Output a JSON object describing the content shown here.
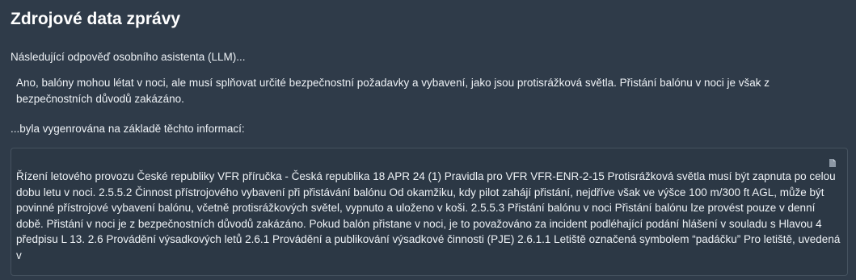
{
  "panel": {
    "title": "Zdrojové data zprávy",
    "intro": "Následující odpověď osobního asistenta (LLM)...",
    "answer": "Ano, balóny mohou létat v noci, ale musí splňovat určité bezpečnostní požadavky a vybavení, jako jsou protisrážková světla. Přistání balónu v noci je však z bezpečnostních důvodů zakázáno.",
    "basis": "...byla vygenrována na základě těchto informací:",
    "source": {
      "icon": "document-icon",
      "text": "Řízení letového provozu České republiky VFR příručka - Česká republika 18 APR 24 (1) Pravidla pro VFR VFR-ENR-2-15 Protisrážková světla musí být zapnuta po celou dobu letu v noci. 2.5.5.2 Činnost přístrojového vybavení při přistávání balónu Od okamžiku, kdy pilot zahájí přistání, nejdříve však ve výšce 100 m/300 ft AGL, může být povinné přístrojové vybavení balónu, včetně protisrážkových světel, vypnuto a uloženo v koši. 2.5.5.3 Přistání balónu v noci Přistání balónu lze provést pouze v denní době. Přistání v noci je z bezpečnostních důvodů zakázáno. Pokud balón přistane v noci, je to považováno za incident podléhající podání hlášení v souladu s Hlavou 4 předpisu L 13. 2.6 Provádění výsadkových letů 2.6.1 Provádění a publikování výsadkové činnosti (PJE) 2.6.1.1 Letiště označená symbolem “padáčku” Pro letiště, uvedená v"
    }
  },
  "colors": {
    "background": "#2f3b49",
    "box_background": "#2c3845",
    "box_border": "#45525f",
    "text": "#eef2f6"
  }
}
